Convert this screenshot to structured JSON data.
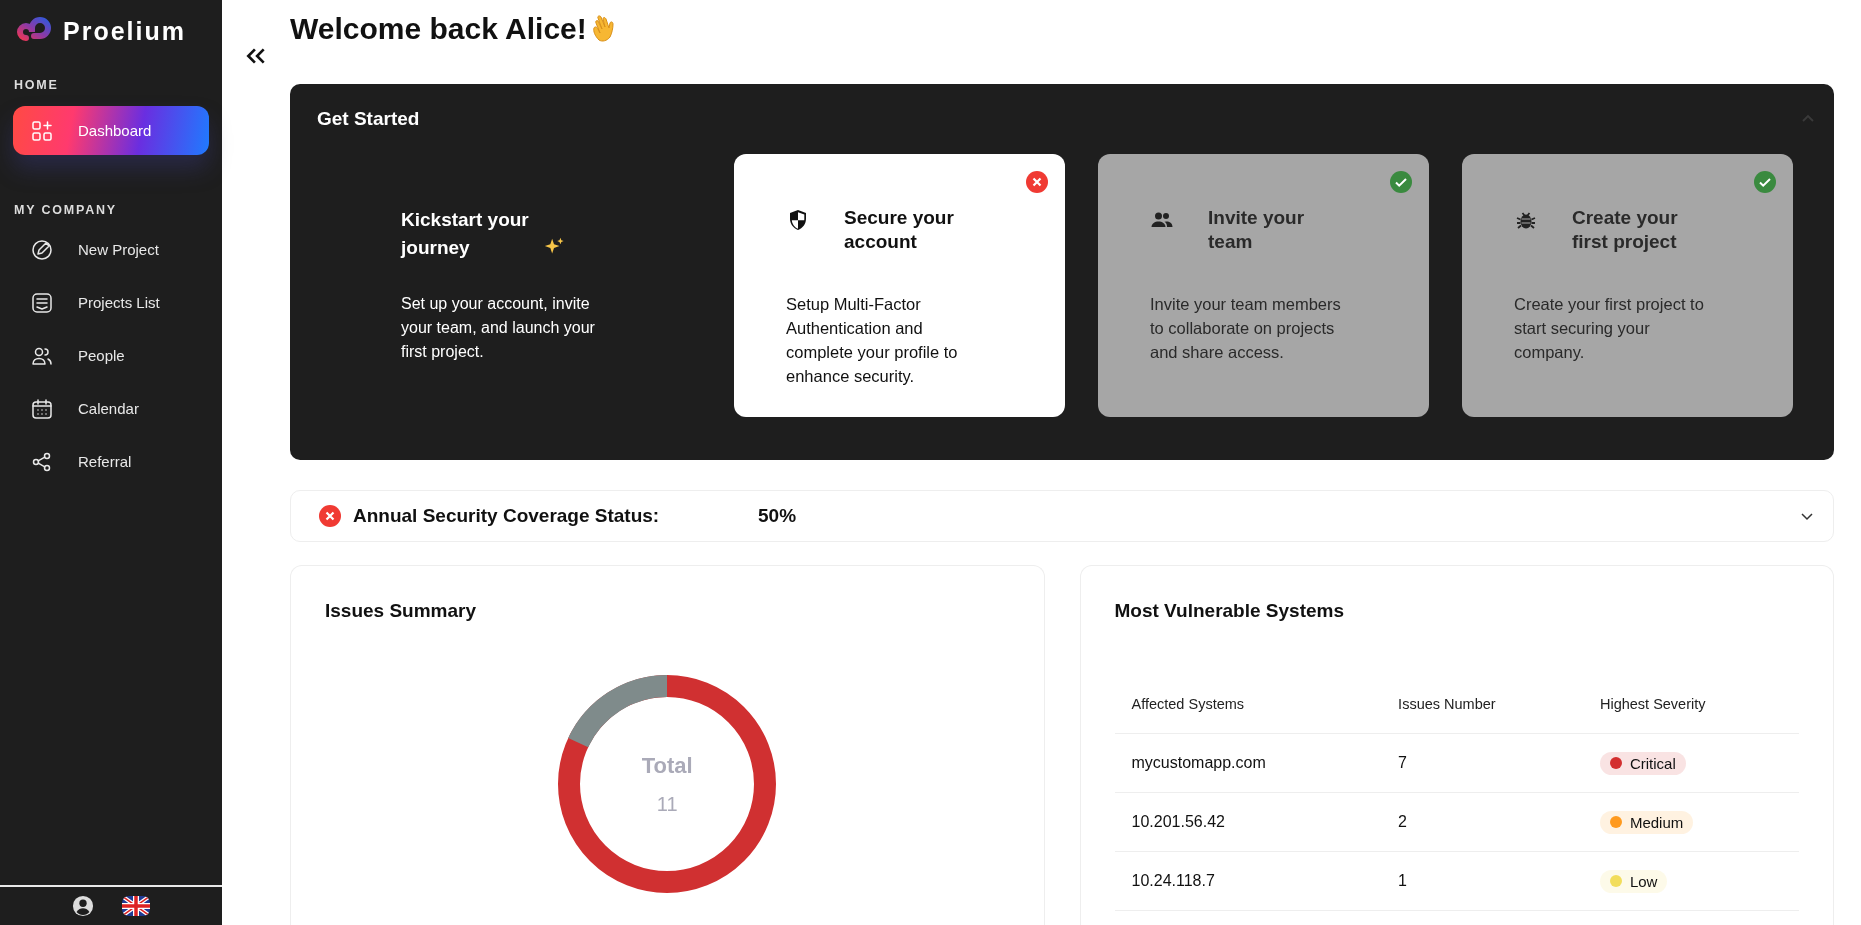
{
  "sidebar": {
    "brand": "Proelium",
    "sections": [
      {
        "title": "HOME",
        "items": [
          {
            "label": "Dashboard",
            "kind": "dashboard",
            "selected": true
          }
        ]
      },
      {
        "title": "MY COMPANY",
        "items": [
          {
            "label": "New Project",
            "kind": "pencil",
            "selected": false
          },
          {
            "label": "Projects List",
            "kind": "list",
            "selected": false
          },
          {
            "label": "People",
            "kind": "people",
            "selected": false
          },
          {
            "label": "Calendar",
            "kind": "calendar",
            "selected": false
          },
          {
            "label": "Referral",
            "kind": "share",
            "selected": false
          }
        ]
      }
    ]
  },
  "header": {
    "title": "Welcome back Alice!"
  },
  "get_started": {
    "title": "Get Started",
    "expanded": true,
    "intro": {
      "title": "Kickstart your journey",
      "text": "Set up your account, invite your team, and launch your first project."
    },
    "steps": [
      {
        "kind": "shield",
        "title": "Secure your account",
        "text": "Setup Multi-Factor Authentication and complete your profile to enhance security.",
        "completed": false
      },
      {
        "kind": "team",
        "title": "Invite your team",
        "text": "Invite your team members to collaborate on projects and share access.",
        "completed": true
      },
      {
        "kind": "bug",
        "title": "Create your first project",
        "text": "Create your first project to start securing your company.",
        "completed": true
      }
    ]
  },
  "coverage": {
    "label": "Annual Security Coverage Status:",
    "value": "50%",
    "ok": false,
    "expanded": false
  },
  "issues_summary": {
    "title": "Issues Summary",
    "total_label": "Total",
    "total": "11"
  },
  "vulnerable_systems": {
    "title": "Most Vulnerable Systems",
    "columns": [
      "Affected Systems",
      "Issues Number",
      "Highest Severity"
    ],
    "rows": [
      {
        "system": "mycustomapp.com",
        "issues": "7",
        "severity": "Critical",
        "color": "#d32f2f"
      },
      {
        "system": "10.201.56.42",
        "issues": "2",
        "severity": "Medium",
        "color": "#ff9a1f"
      },
      {
        "system": "10.24.118.7",
        "issues": "1",
        "severity": "Low",
        "color": "#f2dd5c"
      }
    ]
  }
}
